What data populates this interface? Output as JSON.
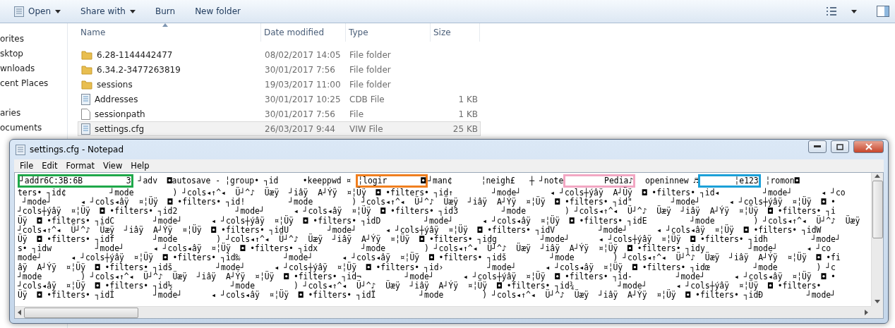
{
  "explorer": {
    "toolbar": {
      "buttons": [
        {
          "label": "Open",
          "has_menu": true,
          "kind": "open"
        },
        {
          "label": "Share with",
          "has_menu": true,
          "kind": "plain"
        },
        {
          "label": "Burn",
          "has_menu": false,
          "kind": "plain"
        },
        {
          "label": "New folder",
          "has_menu": false,
          "kind": "plain"
        }
      ]
    },
    "nav_groups": [
      [
        "orites",
        "sktop",
        "wnloads",
        "cent Places"
      ],
      [
        "aries",
        "ocuments"
      ]
    ],
    "columns": [
      "Name",
      "Date modified",
      "Type",
      "Size"
    ],
    "files": [
      {
        "name": "6.28-1144442477",
        "date": "08/02/2017 14:05",
        "type": "File folder",
        "kind": "folder",
        "selected": false
      },
      {
        "name": "6.34.2-3477263819",
        "date": "30/01/2017 7:56",
        "type": "File folder",
        "kind": "folder",
        "selected": false
      },
      {
        "name": "sessions",
        "date": "19/03/2017 11:00",
        "type": "File folder",
        "kind": "folder",
        "selected": false
      },
      {
        "name": "Addresses",
        "date": "30/01/2017 10:25",
        "type": "CDB File",
        "size": "1 KB",
        "kind": "data",
        "selected": false
      },
      {
        "name": "sessionpath",
        "date": "30/01/2017 7:56",
        "type": "File",
        "size": "1 KB",
        "kind": "blank",
        "selected": false
      },
      {
        "name": "settings.cfg",
        "date": "26/03/2017 9:44",
        "type": "VIW File",
        "size": "25 KB",
        "kind": "data",
        "selected": true
      }
    ]
  },
  "notepad": {
    "title": "settings.cfg - Notepad",
    "menu": [
      "File",
      "Edit",
      "Format",
      "View",
      "Help"
    ],
    "first_line": [
      {
        "text": "┘addr6C:3B:6B         3",
        "color": "#1fa84a"
      },
      {
        "text": " ┘adv  ◘autosave - ╎group• ┐id     •keeppwd ¤ "
      },
      {
        "text": "╎logir       ◘",
        "color": "#f07f1f"
      },
      {
        "text": "┘man¢      ╎neigh£   ┼ ┘note"
      },
      {
        "text": "        Pedia♪",
        "color": "#f2a7c3"
      },
      {
        "text": "  openinnew ♬"
      },
      {
        "text": "       ╎e123",
        "color": "#1ba0d8"
      },
      {
        "text": " ╎romon◘"
      }
    ],
    "lines": [
      "ters• ┐id¢         ┘mode        ) ┘cols◂↑^◂  Ü┘^♪  Üæÿ  ┘iâÿ  A┘Ýÿ  ¤╎Üÿ  ◘ •filters• ┐id↑        ┘mode┘      ◂ ┘cols┼ýâÿ  A┘Üÿ  ◘ •filters• ┐id◂         ┘mode┘      ◂ ┘co",
      " ┘mode┘      ◂ ┘cols◂âÿ  ¤╎Üÿ  ◘ •filters• ┐id!         ┘mode        ) ┘cols◂↑^◂  Ü┘^♪  Üæÿ  ┘iâÿ  A┘Ýÿ  ¤╎Üÿ  ◘ •filters• ┐id\"        ┘mode┘      ◂ ┘cols┼ýâÿ  ¤╎Üÿ  ◘ •",
      "┘cols┼ýâÿ  ¤╎Üÿ  ◘ •filters• ┐id2            ┘mode┘      ◂ ┘cols◂âÿ  ¤╎Üÿ  ◘ •filters• ┐id3         ┘mode        ) ┘cols◂↑^◂  Ü┘^♪  Üæÿ  ┘iâÿ  A┘Ýÿ  ¤╎Üÿ  ◘ •filters• ┐i",
      "Üÿ  ◘ •filters• ┐idC        ┘mode┘      ◂ ┘cols┼ýâÿ  ¤╎Üÿ  ◘ •filters• ┐idD         ┘mode┘      ◂ ┘cols◂âÿ  ¤╎Üÿ  ◘ •filters• ┐idE         ┘mode        ) ┘cols◂↑^◂  Ü┘^♪  Üæÿ",
      "┘cols◂↑^◂  Ü┘^♪  Üæÿ  ┘iâÿ  A┘Ýÿ  ¤╎Üÿ  ◘ •filters• ┐idU        ┘mode┘      ◂ ┘cols┼ýâÿ  ¤╎Üÿ  ◘ •filters• ┐idV         ┘mode┘      ◂ ┘cols◂âÿ  ¤╎Üÿ  ◘ •filters• ┐idW",
      "Üÿ  ◘ •filters• ┐idf        ┘mode        ) ┘cols◂↑^◂  Ü┘^♪  Üæÿ  ┘iâÿ  A┘Ýÿ  ¤╎Üÿ  ◘ •filters• ┐idg         ┘mode┘      ◂ ┘cols┼ýâÿ  ¤╎Üÿ  ◘ •filters• ┐idh         ┘mode┘",
      "s• ┐idw         ┘mode┘      ◂ ┘cols◂âÿ  ¤╎Üÿ  ◘ •filters• ┐idx         ┘mode        ) ┘cols◂↑^◂  Ü┘^♪  Üæÿ  ┘iâÿ  A┘Ýÿ  ¤╎Üÿ  ◘ •filters• ┐idy         ┘mode┘      ◂ ┘co",
      "mode┘      ◂ ┘cols┼ýâÿ  ¤╎Üÿ  ◘ •filters• ┐id‰         ┘mode┘      ◂ ┘cols◂âÿ  ¤╎Üÿ  ◘ •filters• ┐idš         ┘mode        ) ┘cols◂↑^◂  Ü┘^♪  Üæÿ  ┘iâÿ  A┘Ýÿ  ¤╎Üÿ  ◘ •fi",
      "âÿ  A┘Ýÿ  ¤╎Üÿ  ◘ •filters• ┐idš         ┘mode┘      ◂ ┘cols┼ýâÿ  ¤╎Üÿ  ◘ •filters• ┐id›         ┘mode┘      ◂ ┘cols◂âÿ  ¤╎Üÿ  ◘ •filters• ┐idœ         ┘mode        ) ┘c",
      "┘mode        ) ┘cols◂↑^◂  Ü┘^♪  Üæÿ  ┘iâÿ  A┘Ýÿ  ¤╎Üÿ  ◘ •filters• ┐id¬         ┘mode┘      ◂ ┘cols┼ýâÿ  ¤╎Üÿ  ◘ •filters• ┐id-         ┘mode┘      ◂ ┘cols◂âÿ  ¤╎Üÿ  ◘ •",
      "┘cols◂âÿ  ¤╎Üÿ  ◘ •filters• ┐id½            ┘mode        ) ┘cols◂↑^◂  Ü┘^♪  Üæÿ  ┘iâÿ  A┘Ýÿ  ¤╎Üÿ  ◘ •filters• ┐id¾         ┘mode┘      ◂ ┘cols┼ýâÿ  ¤╎Üÿ  ◘ •filters•",
      "Üÿ  ◘ •filters• ┐idÎ        ┘mode┘      ◂ ┘cols◂âÿ  ¤╎Üÿ  ◘ •filters• ┐idÏ         ┘mode        ) ┘cols◂↑^◂  Ü┘^♪  Üæÿ  ┘iâÿ  A┘Ýÿ  ¤╎Üÿ  ◘ •filters• ┐idÐ         ┘mode┘"
    ]
  }
}
